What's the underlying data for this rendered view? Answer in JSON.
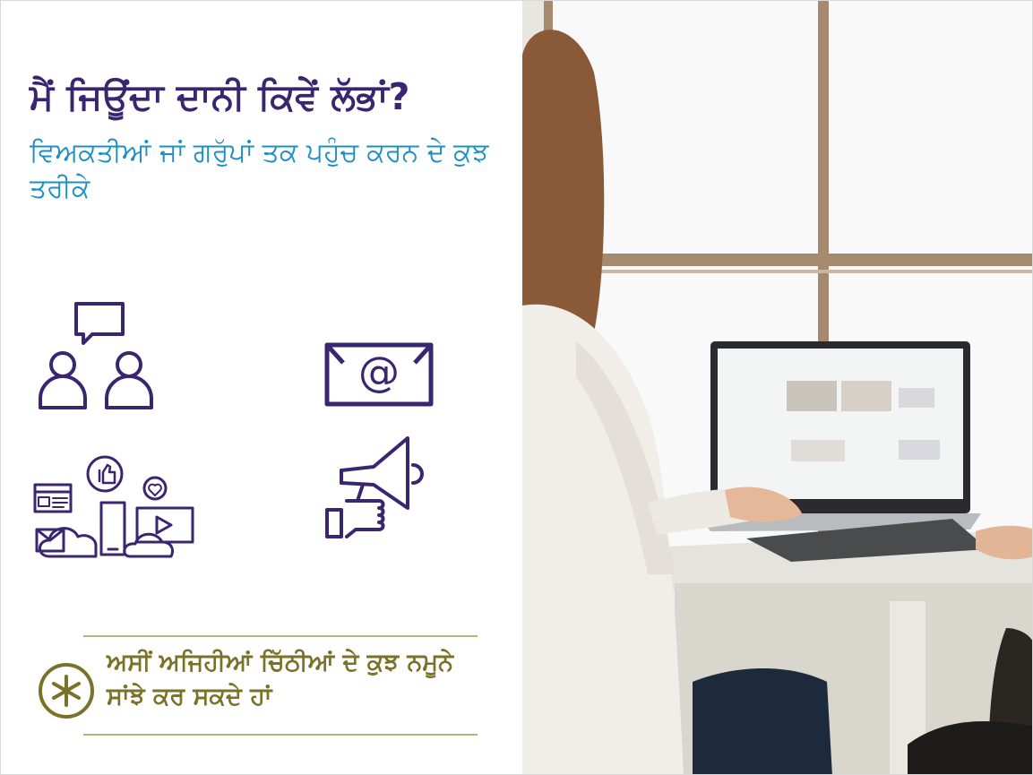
{
  "slide": {
    "title": "ਮੈਂ ਜਿਊਂਦਾ ਦਾਨੀ ਕਿਵੇਂ ਲੱਭਾਂ?",
    "subtitle": "ਵਿਅਕਤੀਆਂ ਜਾਂ ਗਰੁੱਪਾਂ ਤਕ ਪਹੁੰਚ ਕਰਨ ਦੇ ਕੁਝ ਤਰੀਕੇ",
    "note": "ਅਸੀਂ ਅਜਿਹੀਆਂ ਚਿੱਠੀਆਂ ਦੇ ਕੁਝ ਨਮੂਨੇ ਸਾਂਝੇ ਕਰ ਸਕਦੇ ਹਾਂ"
  },
  "icons": [
    "people-conversation-icon",
    "email-icon",
    "social-media-icon",
    "megaphone-icon",
    "asterisk-icon"
  ],
  "colors": {
    "title": "#3a2670",
    "subtitle": "#1d8fc4",
    "icon": "#3a2670",
    "note": "#7a7228",
    "rule": "#b8b57a"
  }
}
